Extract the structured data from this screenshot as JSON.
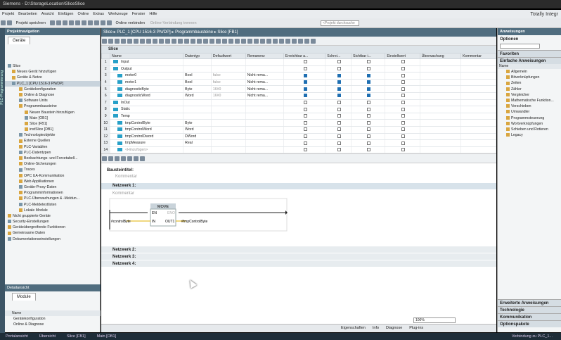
{
  "window_title": "Siemens - D:\\StorageLocation\\SliceSlice",
  "menu": [
    "Projekt",
    "Bearbeiten",
    "Ansicht",
    "Einfügen",
    "Online",
    "Extras",
    "Werkzeuge",
    "Fenster",
    "Hilfe"
  ],
  "brand": "Totally Integr",
  "toolbar": {
    "save": "Projekt speichern",
    "online": "Online verbinden",
    "offline": "Online-Verbindung trennen",
    "search_placeholder": "<Projekt durchsuche"
  },
  "side_strip": "PLC-Programmierung",
  "left": {
    "title": "Projektnavigation",
    "tab": "Geräte",
    "tree": [
      "Slice",
      "Neues Gerät hinzufügen",
      "Geräte & Netze",
      "PLC_1 [CPU 1516-3 PN/DP]",
      "Gerätekonfiguration",
      "Online & Diagnose",
      "Software Units",
      "Programmbausteine",
      "Neuen Baustein hinzufügen",
      "Main [OB1]",
      "Slice [FB1]",
      "instSlice [DB1]",
      "Technologieobjekte",
      "Externe Quellen",
      "PLC-Variablen",
      "PLC-Datentypen",
      "Beobachtungs- und Forcetabell...",
      "Online-Sicherungen",
      "Traces",
      "OPC UA-Kommunikation",
      "Web Applikationen",
      "Geräte-Proxy-Daten",
      "Programminformationen",
      "PLC-Überwachungen & -Meldun...",
      "PLC-Meldetextlisten",
      "Lokale Module",
      "Nicht gruppierte Geräte",
      "Security-Einstellungen",
      "Geräteübergreifende Funktionen",
      "Gemeinsame Daten",
      "Dokumentationseinstellungen"
    ],
    "detail_title": "Detailansicht",
    "detail_tab": "Module",
    "detail_header": "Name",
    "detail_items": [
      "Gerätekonfiguration",
      "Online & Diagnose"
    ]
  },
  "breadcrumb": "Slice ▸ PLC_1 [CPU 1516-3 PN/DP] ▸ Programmbausteine ▸ Slice [FB1]",
  "block": {
    "name": "Slice",
    "headers": [
      "",
      "Name",
      "Datentyp",
      "Defaultwert",
      "Remanenz",
      "Erreichbar a...",
      "Schrei...",
      "Sichtbar i...",
      "Einstellwert",
      "Überwachung",
      "Kommentar"
    ],
    "rows": [
      {
        "n": "1",
        "name": "Input",
        "type": "",
        "def": "",
        "rem": "",
        "c": [
          0,
          0,
          0,
          0
        ]
      },
      {
        "n": "2",
        "name": "Output",
        "type": "",
        "def": "",
        "rem": "",
        "c": [
          0,
          0,
          0,
          0
        ]
      },
      {
        "n": "3",
        "name": "motor0",
        "type": "Bool",
        "def": "false",
        "rem": "Nicht rema...",
        "c": [
          1,
          1,
          1,
          0
        ]
      },
      {
        "n": "4",
        "name": "motor1",
        "type": "Bool",
        "def": "false",
        "rem": "Nicht rema...",
        "c": [
          1,
          1,
          1,
          0
        ]
      },
      {
        "n": "5",
        "name": "diagnosticByte",
        "type": "Byte",
        "def": "16#0",
        "rem": "Nicht rema...",
        "c": [
          1,
          1,
          1,
          0
        ]
      },
      {
        "n": "6",
        "name": "diagnosticWord",
        "type": "Word",
        "def": "16#0",
        "rem": "Nicht rema...",
        "c": [
          1,
          1,
          1,
          0
        ]
      },
      {
        "n": "7",
        "name": "InOut",
        "type": "",
        "def": "",
        "rem": "",
        "c": [
          0,
          0,
          0,
          0
        ]
      },
      {
        "n": "8",
        "name": "Static",
        "type": "",
        "def": "",
        "rem": "",
        "c": [
          0,
          0,
          0,
          0
        ]
      },
      {
        "n": "9",
        "name": "Temp",
        "type": "",
        "def": "",
        "rem": "",
        "c": [
          0,
          0,
          0,
          0
        ]
      },
      {
        "n": "10",
        "name": "tmpControlByte",
        "type": "Byte",
        "def": "",
        "rem": "",
        "c": [
          0,
          0,
          0,
          0
        ]
      },
      {
        "n": "11",
        "name": "tmpControlWord",
        "type": "Word",
        "def": "",
        "rem": "",
        "c": [
          0,
          0,
          0,
          0
        ]
      },
      {
        "n": "12",
        "name": "tmpControlDword",
        "type": "DWord",
        "def": "",
        "rem": "",
        "c": [
          0,
          0,
          0,
          0
        ]
      },
      {
        "n": "13",
        "name": "tmpMeasure",
        "type": "Real",
        "def": "",
        "rem": "",
        "c": [
          0,
          0,
          0,
          0
        ]
      },
      {
        "n": "14",
        "name": "<Hinzufügen>",
        "type": "",
        "def": "",
        "rem": "",
        "c": [
          0,
          0,
          0,
          0
        ]
      }
    ]
  },
  "ladder": {
    "block_title": "Bausteintitel:",
    "comment": "Kommentar",
    "net1": "Netzwerk 1:",
    "net_comment": "Kommentar",
    "move": "MOVE",
    "en": "EN",
    "eno": "ENO",
    "in": "IN",
    "out1": "OUT1",
    "in_var": "#controlByte",
    "out_var": "#tmpControlByte",
    "networks": [
      "Netzwerk 2:",
      "Netzwerk 3:",
      "Netzwerk 4:"
    ]
  },
  "right": {
    "title": "Anweisungen",
    "options": "Optionen",
    "favorites": "Favoriten",
    "basic": "Einfache Anweisungen",
    "name_col": "Name",
    "items": [
      "Allgemein",
      "Bitverknüpfungen",
      "Zeiten",
      "Zähler",
      "Vergleicher",
      "Mathematische Funktion...",
      "Verschieben",
      "Umwandler",
      "Programmsteuerung",
      "Wortverknüpfungen",
      "Schieben und Rotieren",
      "Legacy"
    ],
    "sections": [
      "Erweiterte Anweisungen",
      "Technologie",
      "Kommunikation",
      "Optionspakete"
    ]
  },
  "status": {
    "zoom": "100%",
    "tabs": [
      "Eigenschaften",
      "Info",
      "Diagnose",
      "Plug-ins"
    ]
  },
  "taskbar": [
    "Portalansicht",
    "Übersicht",
    "Slice [FB1]",
    "Main [OB1]"
  ],
  "taskbar_status": "Verbindung zu PLC_1..."
}
